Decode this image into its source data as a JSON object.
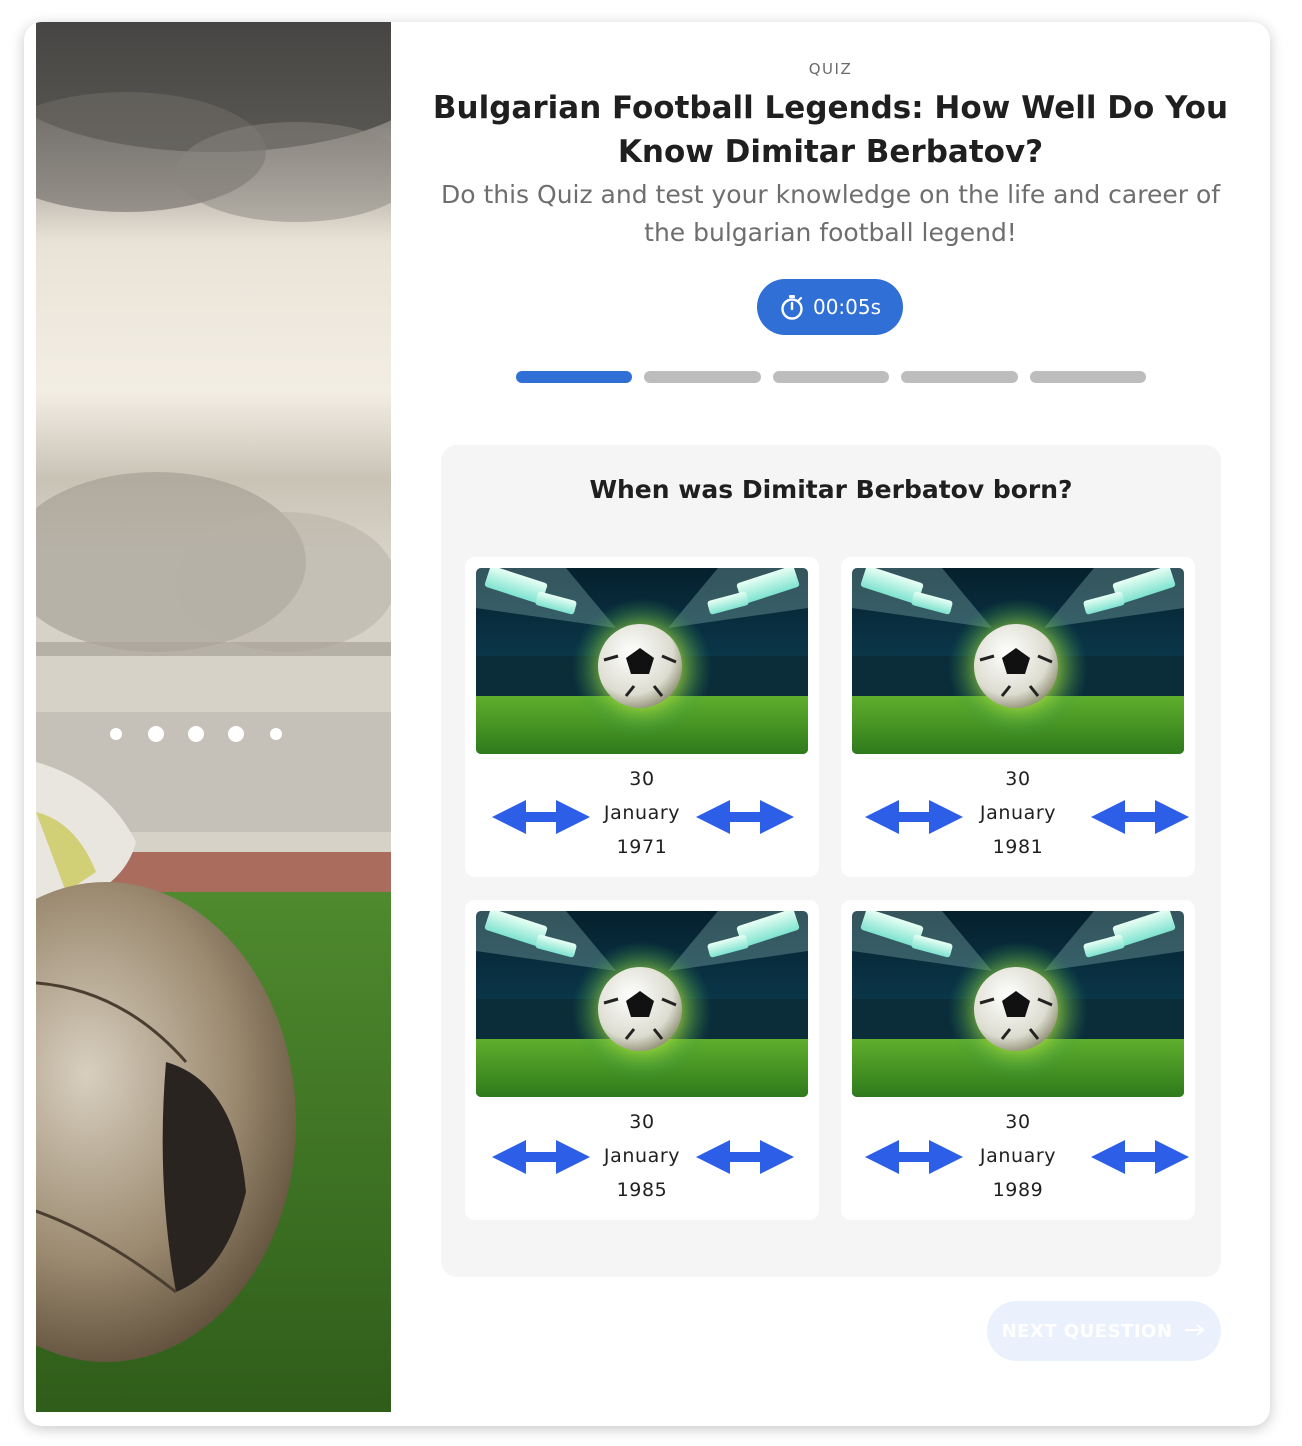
{
  "hero": {
    "image": "soccer-stadium-hero-image"
  },
  "header": {
    "eyebrow": "QUIZ",
    "title": "Bulgarian Football Legends: How Well Do You Know Dimitar Berbatov?",
    "subtitle": "Do this Quiz and test your knowledge on the life and career of the bulgarian football legend!"
  },
  "timer": {
    "icon": "stopwatch-icon",
    "value": "00:05s"
  },
  "progress": {
    "total_steps": 5,
    "current_step": 1,
    "active_color": "#2f6fd6",
    "inactive_color": "#bdbdbd"
  },
  "question": {
    "text": "When was Dimitar Berbatov born?",
    "options": [
      {
        "day": "30",
        "month": "January",
        "year": "1971",
        "image": "glowing-football-stadium-image",
        "arrow_icon": "double-arrow-icon"
      },
      {
        "day": "30",
        "month": "January",
        "year": "1981",
        "image": "glowing-football-stadium-image",
        "arrow_icon": "double-arrow-icon"
      },
      {
        "day": "30",
        "month": "January",
        "year": "1985",
        "image": "glowing-football-stadium-image",
        "arrow_icon": "double-arrow-icon"
      },
      {
        "day": "30",
        "month": "January",
        "year": "1989",
        "image": "glowing-football-stadium-image",
        "arrow_icon": "double-arrow-icon"
      }
    ]
  },
  "next_button": {
    "label": "NEXT QUESTION",
    "icon": "arrow-right-icon",
    "enabled": false
  },
  "colors": {
    "accent": "#2f6fd6",
    "arrow_blue": "#2d5ee8",
    "panel_bg": "#f5f5f5"
  }
}
